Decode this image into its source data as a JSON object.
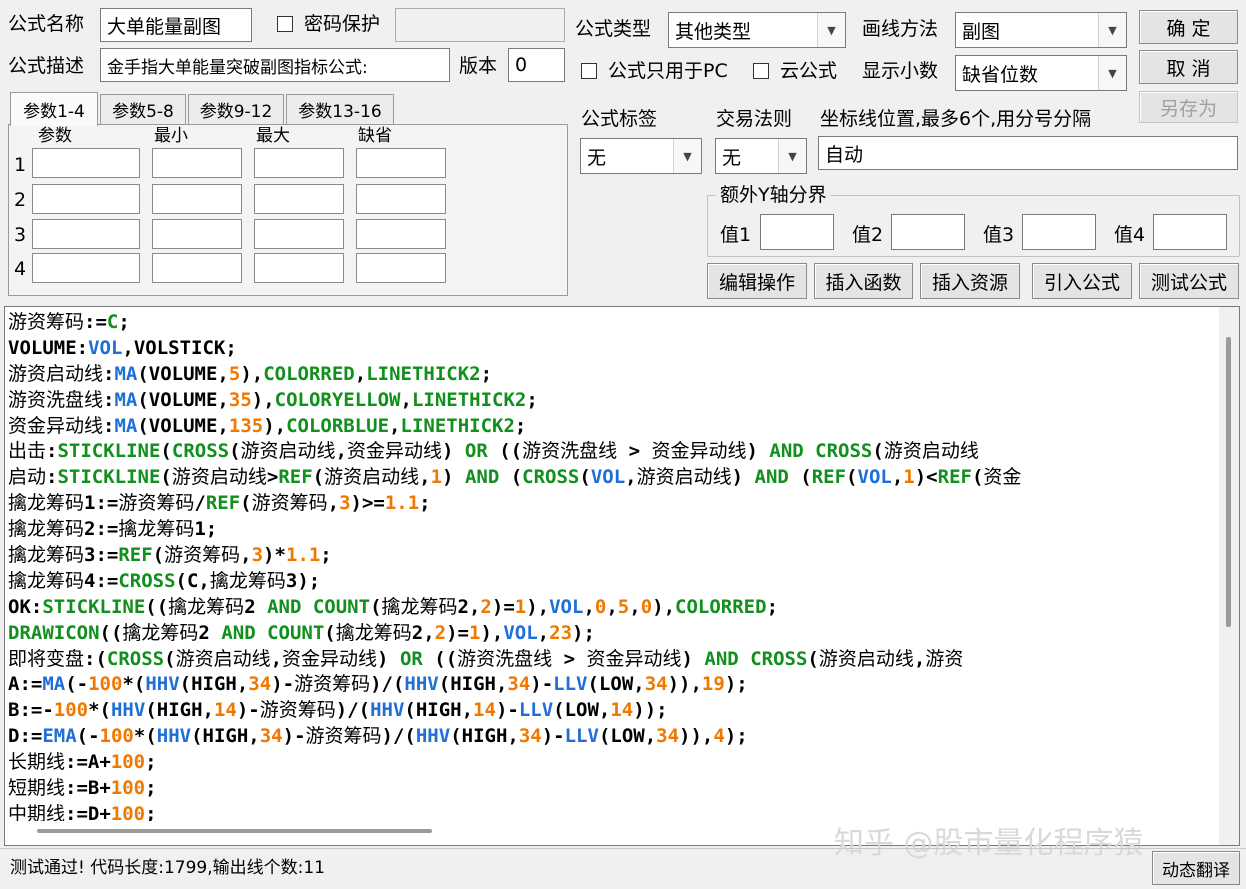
{
  "formula": {
    "name_label": "公式名称",
    "name_value": "大单能量副图",
    "password_label": "密码保护",
    "password_value": "",
    "desc_label": "公式描述",
    "desc_value": "金手指大单能量突破副图指标公式:",
    "version_label": "版本",
    "version_value": "0"
  },
  "options": {
    "type_label": "公式类型",
    "type_value": "其他类型",
    "draw_label": "画线方法",
    "draw_value": "副图",
    "pc_only_label": "公式只用于PC",
    "cloud_label": "云公式",
    "decimal_label": "显示小数",
    "decimal_value": "缺省位数",
    "tag_label": "公式标签",
    "tag_value": "无",
    "trade_label": "交易法则",
    "trade_value": "无",
    "axis_label": "坐标线位置,最多6个,用分号分隔",
    "axis_value": "自动",
    "extra_y_label": "额外Y轴分界",
    "val1_label": "值1",
    "val2_label": "值2",
    "val3_label": "值3",
    "val4_label": "值4"
  },
  "buttons": {
    "ok": "确 定",
    "cancel": "取 消",
    "save_as": "另存为",
    "edit_ops": "编辑操作",
    "insert_func": "插入函数",
    "insert_res": "插入资源",
    "import_formula": "引入公式",
    "test_formula": "测试公式",
    "dyn_translate": "动态翻译"
  },
  "tabs": [
    "参数1-4",
    "参数5-8",
    "参数9-12",
    "参数13-16"
  ],
  "params": {
    "headers": [
      "参数",
      "最小",
      "最大",
      "缺省"
    ],
    "rows": [
      "1",
      "2",
      "3",
      "4"
    ]
  },
  "code_lines": [
    [
      [
        "k",
        "游资筹码:="
      ],
      [
        "g",
        "C"
      ],
      [
        "k",
        ";"
      ]
    ],
    [
      [
        "k",
        "VOLUME:"
      ],
      [
        "f",
        "VOL"
      ],
      [
        "k",
        ",VOLSTICK;"
      ]
    ],
    [
      [
        "k",
        "游资启动线:"
      ],
      [
        "f",
        "MA"
      ],
      [
        "k",
        "(VOLUME,"
      ],
      [
        "n",
        "5"
      ],
      [
        "k",
        "),"
      ],
      [
        "g",
        "COLORRED"
      ],
      [
        "k",
        ","
      ],
      [
        "g",
        "LINETHICK2"
      ],
      [
        "k",
        ";"
      ]
    ],
    [
      [
        "k",
        "游资洗盘线:"
      ],
      [
        "f",
        "MA"
      ],
      [
        "k",
        "(VOLUME,"
      ],
      [
        "n",
        "35"
      ],
      [
        "k",
        "),"
      ],
      [
        "g",
        "COLORYELLOW"
      ],
      [
        "k",
        ","
      ],
      [
        "g",
        "LINETHICK2"
      ],
      [
        "k",
        ";"
      ]
    ],
    [
      [
        "k",
        "资金异动线:"
      ],
      [
        "f",
        "MA"
      ],
      [
        "k",
        "(VOLUME,"
      ],
      [
        "n",
        "135"
      ],
      [
        "k",
        "),"
      ],
      [
        "g",
        "COLORBLUE"
      ],
      [
        "k",
        ","
      ],
      [
        "g",
        "LINETHICK2"
      ],
      [
        "k",
        ";"
      ]
    ],
    [
      [
        "k",
        "出击:"
      ],
      [
        "g",
        "STICKLINE"
      ],
      [
        "k",
        "("
      ],
      [
        "g",
        "CROSS"
      ],
      [
        "k",
        "(游资启动线,资金异动线) "
      ],
      [
        "g",
        "OR"
      ],
      [
        "k",
        " ((游资洗盘线 > 资金异动线) "
      ],
      [
        "g",
        "AND"
      ],
      [
        "k",
        " "
      ],
      [
        "g",
        "CROSS"
      ],
      [
        "k",
        "(游资启动线"
      ]
    ],
    [
      [
        "k",
        "启动:"
      ],
      [
        "g",
        "STICKLINE"
      ],
      [
        "k",
        "(游资启动线>"
      ],
      [
        "g",
        "REF"
      ],
      [
        "k",
        "(游资启动线,"
      ],
      [
        "n",
        "1"
      ],
      [
        "k",
        ") "
      ],
      [
        "g",
        "AND"
      ],
      [
        "k",
        " ("
      ],
      [
        "g",
        "CROSS"
      ],
      [
        "k",
        "("
      ],
      [
        "f",
        "VOL"
      ],
      [
        "k",
        ",游资启动线) "
      ],
      [
        "g",
        "AND"
      ],
      [
        "k",
        " ("
      ],
      [
        "g",
        "REF"
      ],
      [
        "k",
        "("
      ],
      [
        "f",
        "VOL"
      ],
      [
        "k",
        ","
      ],
      [
        "n",
        "1"
      ],
      [
        "k",
        ")<"
      ],
      [
        "g",
        "REF"
      ],
      [
        "k",
        "(资金"
      ]
    ],
    [
      [
        "k",
        "擒龙筹码1:=游资筹码/"
      ],
      [
        "g",
        "REF"
      ],
      [
        "k",
        "(游资筹码,"
      ],
      [
        "n",
        "3"
      ],
      [
        "k",
        ")>="
      ],
      [
        "n",
        "1.1"
      ],
      [
        "k",
        ";"
      ]
    ],
    [
      [
        "k",
        "擒龙筹码2:=擒龙筹码1;"
      ]
    ],
    [
      [
        "k",
        "擒龙筹码3:="
      ],
      [
        "g",
        "REF"
      ],
      [
        "k",
        "(游资筹码,"
      ],
      [
        "n",
        "3"
      ],
      [
        "k",
        ")*"
      ],
      [
        "n",
        "1.1"
      ],
      [
        "k",
        ";"
      ]
    ],
    [
      [
        "k",
        "擒龙筹码4:="
      ],
      [
        "g",
        "CROSS"
      ],
      [
        "k",
        "(C,擒龙筹码3);"
      ]
    ],
    [
      [
        "k",
        "OK:"
      ],
      [
        "g",
        "STICKLINE"
      ],
      [
        "k",
        "((擒龙筹码2 "
      ],
      [
        "g",
        "AND"
      ],
      [
        "k",
        " "
      ],
      [
        "g",
        "COUNT"
      ],
      [
        "k",
        "(擒龙筹码2,"
      ],
      [
        "n",
        "2"
      ],
      [
        "k",
        ")="
      ],
      [
        "n",
        "1"
      ],
      [
        "k",
        "),"
      ],
      [
        "f",
        "VOL"
      ],
      [
        "k",
        ","
      ],
      [
        "n",
        "0"
      ],
      [
        "k",
        ","
      ],
      [
        "n",
        "5"
      ],
      [
        "k",
        ","
      ],
      [
        "n",
        "0"
      ],
      [
        "k",
        "),"
      ],
      [
        "g",
        "COLORRED"
      ],
      [
        "k",
        ";"
      ]
    ],
    [
      [
        "g",
        "DRAWICON"
      ],
      [
        "k",
        "((擒龙筹码2 "
      ],
      [
        "g",
        "AND"
      ],
      [
        "k",
        " "
      ],
      [
        "g",
        "COUNT"
      ],
      [
        "k",
        "(擒龙筹码2,"
      ],
      [
        "n",
        "2"
      ],
      [
        "k",
        ")="
      ],
      [
        "n",
        "1"
      ],
      [
        "k",
        "),"
      ],
      [
        "f",
        "VOL"
      ],
      [
        "k",
        ","
      ],
      [
        "n",
        "23"
      ],
      [
        "k",
        ");"
      ]
    ],
    [
      [
        "k",
        "即将变盘:("
      ],
      [
        "g",
        "CROSS"
      ],
      [
        "k",
        "(游资启动线,资金异动线) "
      ],
      [
        "g",
        "OR"
      ],
      [
        "k",
        " ((游资洗盘线 > 资金异动线) "
      ],
      [
        "g",
        "AND"
      ],
      [
        "k",
        " "
      ],
      [
        "g",
        "CROSS"
      ],
      [
        "k",
        "(游资启动线,游资"
      ]
    ],
    [
      [
        "k",
        "A:="
      ],
      [
        "f",
        "MA"
      ],
      [
        "k",
        "(-"
      ],
      [
        "n",
        "100"
      ],
      [
        "k",
        "*("
      ],
      [
        "f",
        "HHV"
      ],
      [
        "k",
        "(HIGH,"
      ],
      [
        "n",
        "34"
      ],
      [
        "k",
        ")-游资筹码)/("
      ],
      [
        "f",
        "HHV"
      ],
      [
        "k",
        "(HIGH,"
      ],
      [
        "n",
        "34"
      ],
      [
        "k",
        ")-"
      ],
      [
        "f",
        "LLV"
      ],
      [
        "k",
        "(LOW,"
      ],
      [
        "n",
        "34"
      ],
      [
        "k",
        ")),"
      ],
      [
        "n",
        "19"
      ],
      [
        "k",
        ");"
      ]
    ],
    [
      [
        "k",
        "B:=-"
      ],
      [
        "n",
        "100"
      ],
      [
        "k",
        "*("
      ],
      [
        "f",
        "HHV"
      ],
      [
        "k",
        "(HIGH,"
      ],
      [
        "n",
        "14"
      ],
      [
        "k",
        ")-游资筹码)/("
      ],
      [
        "f",
        "HHV"
      ],
      [
        "k",
        "(HIGH,"
      ],
      [
        "n",
        "14"
      ],
      [
        "k",
        ")-"
      ],
      [
        "f",
        "LLV"
      ],
      [
        "k",
        "(LOW,"
      ],
      [
        "n",
        "14"
      ],
      [
        "k",
        "));"
      ]
    ],
    [
      [
        "k",
        "D:="
      ],
      [
        "f",
        "EMA"
      ],
      [
        "k",
        "(-"
      ],
      [
        "n",
        "100"
      ],
      [
        "k",
        "*("
      ],
      [
        "f",
        "HHV"
      ],
      [
        "k",
        "(HIGH,"
      ],
      [
        "n",
        "34"
      ],
      [
        "k",
        ")-游资筹码)/("
      ],
      [
        "f",
        "HHV"
      ],
      [
        "k",
        "(HIGH,"
      ],
      [
        "n",
        "34"
      ],
      [
        "k",
        ")-"
      ],
      [
        "f",
        "LLV"
      ],
      [
        "k",
        "(LOW,"
      ],
      [
        "n",
        "34"
      ],
      [
        "k",
        ")),"
      ],
      [
        "n",
        "4"
      ],
      [
        "k",
        ");"
      ]
    ],
    [
      [
        "k",
        "长期线:=A+"
      ],
      [
        "n",
        "100"
      ],
      [
        "k",
        ";"
      ]
    ],
    [
      [
        "k",
        "短期线:=B+"
      ],
      [
        "n",
        "100"
      ],
      [
        "k",
        ";"
      ]
    ],
    [
      [
        "k",
        "中期线:=D+"
      ],
      [
        "n",
        "100"
      ],
      [
        "k",
        ";"
      ]
    ]
  ],
  "status": "测试通过! 代码长度:1799,输出线个数:11",
  "watermark": "知乎 @股市量化程序猿"
}
